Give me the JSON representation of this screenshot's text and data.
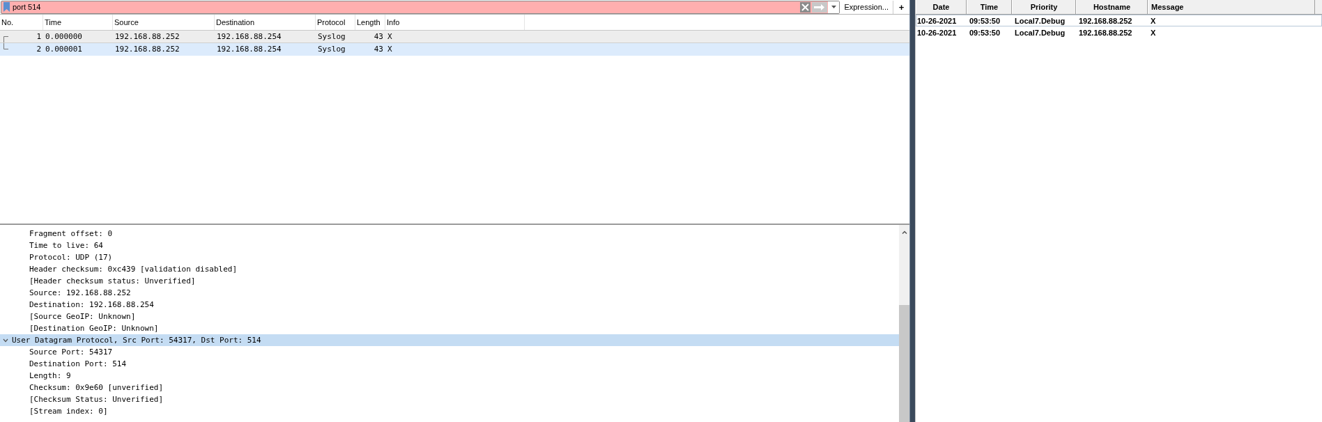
{
  "filter": {
    "value": "port 514",
    "expression_button": "Expression...",
    "add_button": "+"
  },
  "packet_list": {
    "columns": [
      "No.",
      "Time",
      "Source",
      "Destination",
      "Protocol",
      "Length",
      "Info"
    ],
    "rows": [
      {
        "cells": [
          "1",
          "0.000000",
          "192.168.88.252",
          "192.168.88.254",
          "Syslog",
          "43",
          "X"
        ],
        "selected": true,
        "hovered": false
      },
      {
        "cells": [
          "2",
          "0.000001",
          "192.168.88.252",
          "192.168.88.254",
          "Syslog",
          "43",
          "X"
        ],
        "selected": false,
        "hovered": true
      }
    ]
  },
  "details": {
    "tree": [
      {
        "children": [
          {
            "label": "Fragment offset: 0"
          },
          {
            "label": "Time to live: 64"
          },
          {
            "label": "Protocol: UDP (17)"
          },
          {
            "label": "Header checksum: 0xc439 [validation disabled]"
          },
          {
            "label": "[Header checksum status: Unverified]"
          },
          {
            "label": "Source: 192.168.88.252"
          },
          {
            "label": "Destination: 192.168.88.254"
          },
          {
            "label": "[Source GeoIP: Unknown]"
          },
          {
            "label": "[Destination GeoIP: Unknown]"
          }
        ]
      },
      {
        "label": "User Datagram Protocol, Src Port: 54317, Dst Port: 514",
        "expanded": true,
        "selected": true,
        "children": [
          {
            "label": "Source Port: 54317"
          },
          {
            "label": "Destination Port: 514"
          },
          {
            "label": "Length: 9"
          },
          {
            "label": "Checksum: 0x9e60 [unverified]"
          },
          {
            "label": "[Checksum Status: Unverified]"
          },
          {
            "label": "[Stream index: 0]"
          }
        ]
      }
    ]
  },
  "syslog_table": {
    "columns": [
      "Date",
      "Time",
      "Priority",
      "Hostname",
      "Message"
    ],
    "rows": [
      {
        "cells": [
          "10-26-2021",
          "09:53:50",
          "Local7.Debug",
          "192.168.88.252",
          "X"
        ],
        "selected": true
      },
      {
        "cells": [
          "10-26-2021",
          "09:53:50",
          "Local7.Debug",
          "192.168.88.252",
          "X"
        ],
        "selected": false
      }
    ]
  }
}
